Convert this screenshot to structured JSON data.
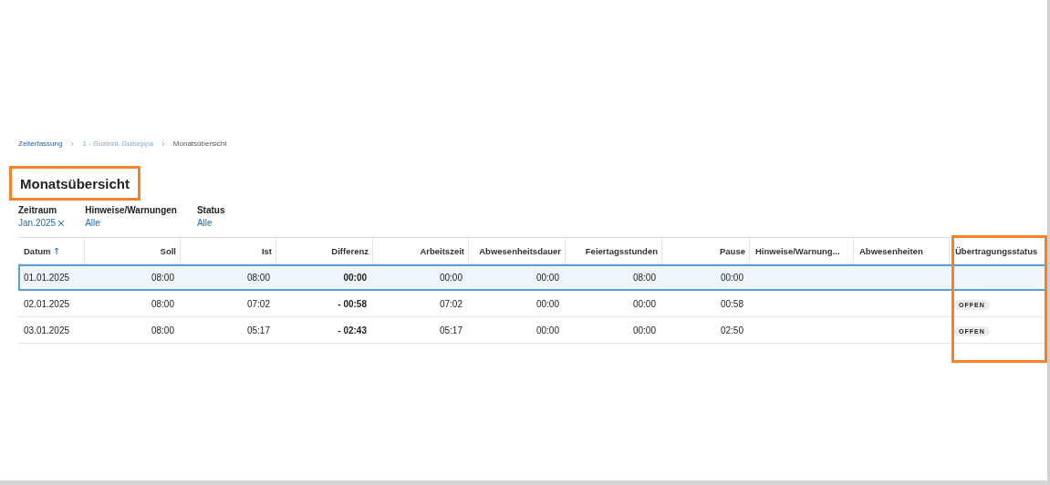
{
  "breadcrumb": [
    {
      "label": "Zeiterfassung",
      "kind": "link"
    },
    {
      "label": "1 - Guzinni, Guiseppa",
      "kind": "link"
    },
    {
      "label": "Monatsübersicht",
      "kind": "current"
    }
  ],
  "title": {
    "text": "Monatsübersicht",
    "highlighted": true
  },
  "filters": [
    {
      "label": "Zeitraum",
      "value": "Jan.2025",
      "clearable": true
    },
    {
      "label": "Hinweise/Warnungen",
      "value": "Alle",
      "clearable": false
    },
    {
      "label": "Status",
      "value": "Alle",
      "clearable": false
    }
  ],
  "table": {
    "columns": [
      {
        "label": "Datum",
        "kind": "date",
        "sorted": true,
        "highlighted": false
      },
      {
        "label": "Soll",
        "kind": "time",
        "sorted": false,
        "highlighted": false
      },
      {
        "label": "Ist",
        "kind": "time",
        "sorted": false,
        "highlighted": false
      },
      {
        "label": "Differenz",
        "kind": "difference",
        "sorted": false,
        "highlighted": false
      },
      {
        "label": "Arbeitszeit",
        "kind": "time",
        "sorted": false,
        "highlighted": false
      },
      {
        "label": "Abwesenheitsdauer",
        "kind": "time",
        "sorted": false,
        "highlighted": false
      },
      {
        "label": "Feiertagsstunden",
        "kind": "time",
        "sorted": false,
        "highlighted": false
      },
      {
        "label": "Pause",
        "kind": "time",
        "sorted": false,
        "highlighted": false
      },
      {
        "label": "Hinweise/Warnung...",
        "kind": "text",
        "sorted": false,
        "highlighted": false
      },
      {
        "label": "Abwesenheiten",
        "kind": "text",
        "sorted": false,
        "highlighted": false
      },
      {
        "label": "Übertragungsstatus",
        "kind": "status",
        "sorted": false,
        "highlighted": true
      }
    ],
    "rows": [
      {
        "selected": true,
        "cells": [
          "01.01.2025",
          "08:00",
          "08:00",
          "00:00",
          "00:00",
          "00:00",
          "08:00",
          "00:00",
          "",
          "",
          ""
        ]
      },
      {
        "selected": false,
        "cells": [
          "02.01.2025",
          "08:00",
          "07:02",
          "- 00:58",
          "07:02",
          "00:00",
          "00:00",
          "00:58",
          "",
          "",
          "OFFEN"
        ]
      },
      {
        "selected": false,
        "cells": [
          "03.01.2025",
          "08:00",
          "05:17",
          "- 02:43",
          "05:17",
          "00:00",
          "00:00",
          "02:50",
          "",
          "",
          "OFFEN"
        ]
      }
    ]
  }
}
